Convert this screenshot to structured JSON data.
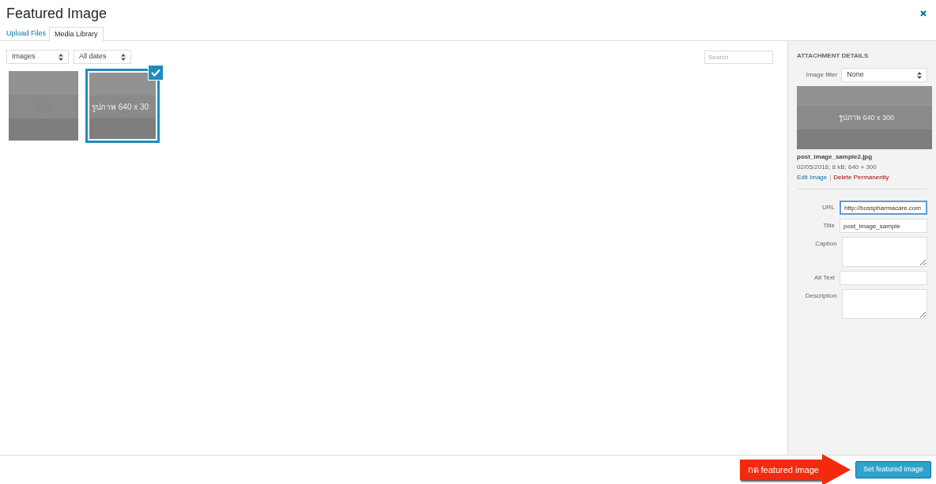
{
  "window": {
    "title": "Featured Image"
  },
  "tabs": [
    {
      "label": "Upload Files",
      "selected": false
    },
    {
      "label": "Media Library",
      "selected": true
    }
  ],
  "filters": [
    {
      "value": "Images"
    },
    {
      "value": "All dates"
    }
  ],
  "search": {
    "placeholder": "Search"
  },
  "attachments": [
    {
      "selected": false
    },
    {
      "text": "รูปภาพ 640 x 30",
      "selected": true
    }
  ],
  "details": {
    "heading": "ATTACHMENT DETAILS",
    "image_filter": {
      "label": "Image filter",
      "value": "None"
    },
    "preview_text": "รูปภาพ 640 x 300",
    "filename": "post_image_sample2.jpg",
    "meta": "02/05/2016; 8 kB; 640 × 300",
    "edit_link": "Edit Image",
    "separator": "|",
    "delete_link": "Delete Permanently",
    "fields": [
      {
        "label": "URL",
        "value": "http://bosspharmacare.com",
        "kind": "input",
        "focused": true
      },
      {
        "label": "Title",
        "value": "post_image_sample",
        "kind": "input",
        "focused": false
      },
      {
        "label": "Caption",
        "kind": "textarea",
        "focused": false
      },
      {
        "label": "Alt Text",
        "kind": "input",
        "focused": false
      },
      {
        "label": "Description",
        "kind": "textarea",
        "focused": false
      }
    ]
  },
  "annotation": {
    "text": "กด featured image"
  },
  "primary_button": "Set featured image"
}
